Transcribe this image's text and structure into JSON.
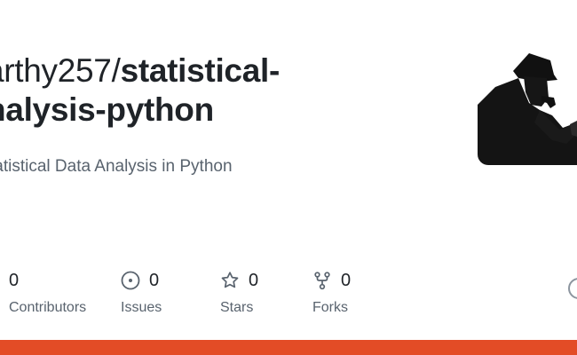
{
  "repo": {
    "owner_text": "arthy257/",
    "name_line1": "statistical-",
    "name_line2": "nalysis-python",
    "description": "tatistical Data Analysis in Python"
  },
  "stats": {
    "contributors": {
      "count": "0",
      "label": "Contributors",
      "icon": "people-icon"
    },
    "issues": {
      "count": "0",
      "label": "Issues",
      "icon": "issue-icon"
    },
    "stars": {
      "count": "0",
      "label": "Stars",
      "icon": "star-icon"
    },
    "forks": {
      "count": "0",
      "label": "Forks",
      "icon": "fork-icon"
    }
  },
  "colors": {
    "language_bar": "#e34c26",
    "muted_text": "#59636e",
    "title_text": "#1f2328"
  }
}
